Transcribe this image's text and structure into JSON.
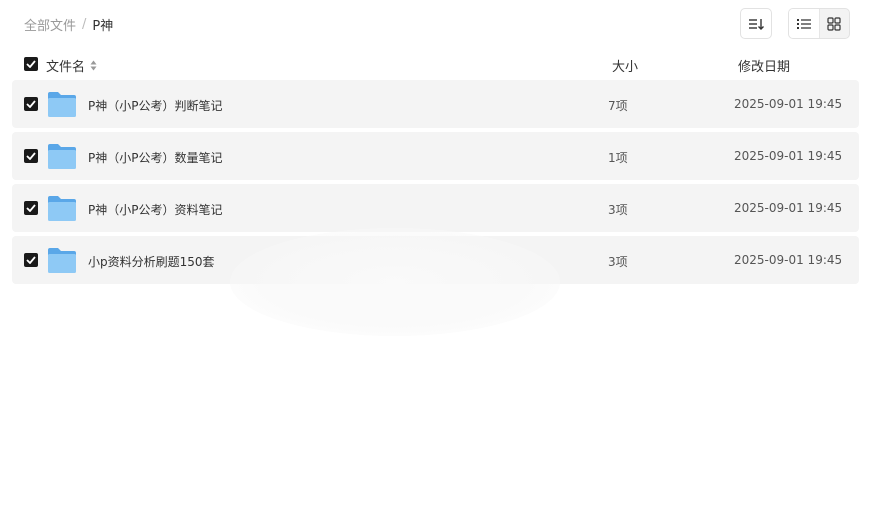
{
  "breadcrumb": {
    "root": "全部文件",
    "separator": "/",
    "current": "P神"
  },
  "toolbar": {
    "sort_icon": "sort-lines-icon",
    "list_view_icon": "list-view-icon",
    "grid_view_icon": "grid-view-icon",
    "active_view": "list"
  },
  "table": {
    "headers": {
      "name": "文件名",
      "size": "大小",
      "date": "修改日期"
    },
    "rows": [
      {
        "name": "P神（小P公考）判断笔记",
        "size": "7项",
        "date": "2025-09-01 19:45",
        "checked": true,
        "icon": "folder-icon"
      },
      {
        "name": "P神（小P公考）数量笔记",
        "size": "1项",
        "date": "2025-09-01 19:45",
        "checked": true,
        "icon": "folder-icon"
      },
      {
        "name": "P神（小P公考）资料笔记",
        "size": "3项",
        "date": "2025-09-01 19:45",
        "checked": true,
        "icon": "folder-icon"
      },
      {
        "name": "小p资料分析刷题150套",
        "size": "3项",
        "date": "2025-09-01 19:45",
        "checked": true,
        "icon": "folder-icon"
      }
    ]
  },
  "colors": {
    "row_background": "#f4f4f4",
    "checkbox": "#1a1a1a",
    "folder": "#7dbcf0"
  }
}
